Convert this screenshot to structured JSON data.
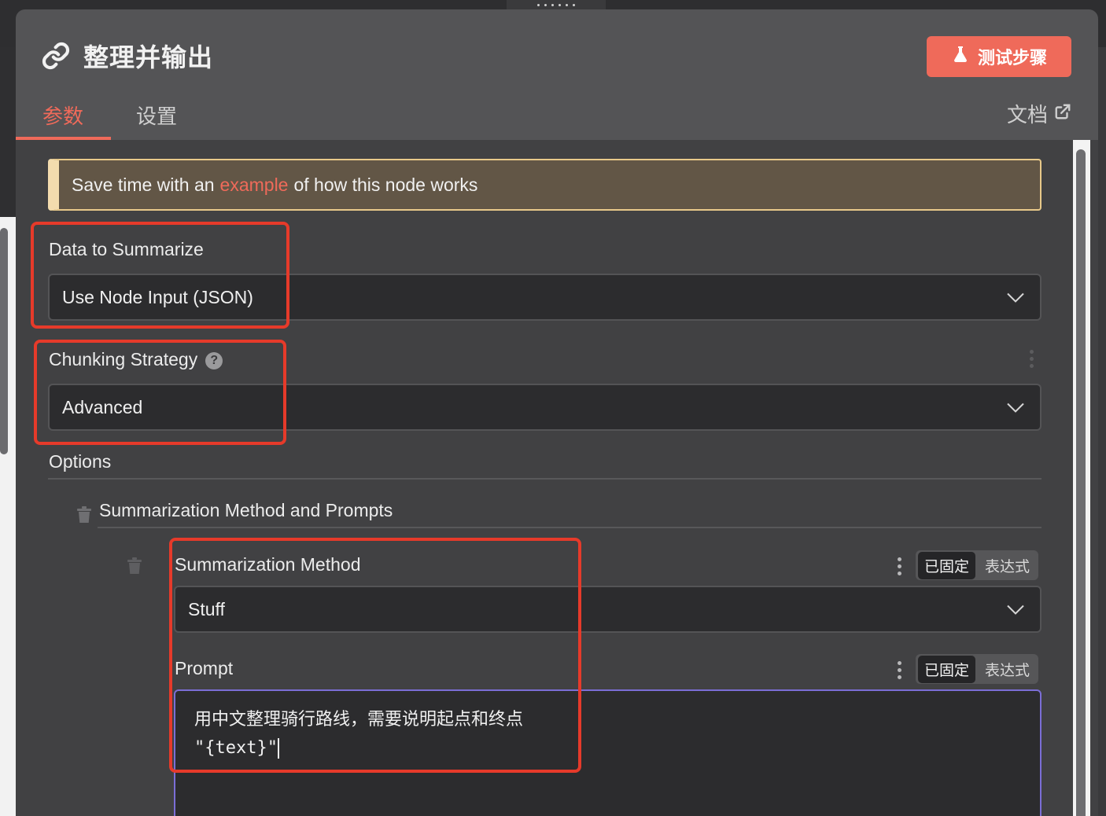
{
  "node": {
    "title": "整理并输出",
    "test_button": "测试步骤"
  },
  "tabs": [
    {
      "label": "参数",
      "active": true
    },
    {
      "label": "设置",
      "active": false
    }
  ],
  "docs_label": "文档",
  "banner": {
    "prefix": "Save time with an",
    "link": "example",
    "suffix": "of how this node works"
  },
  "fields": {
    "data_to_summarize": {
      "label": "Data to Summarize",
      "value": "Use Node Input (JSON)"
    },
    "chunking_strategy": {
      "label": "Chunking Strategy",
      "value": "Advanced"
    },
    "options_label": "Options",
    "summarization_group_label": "Summarization Method and Prompts",
    "summarization_method": {
      "label": "Summarization Method",
      "value": "Stuff"
    },
    "prompt": {
      "label": "Prompt",
      "line1": "用中文整理骑行路线，需要说明起点和终点",
      "line2": "\"{text}\""
    }
  },
  "mode_toggle": {
    "fixed": "已固定",
    "expression": "表达式"
  },
  "colors": {
    "accent": "#ef6a5a",
    "highlight": "#e63a2a",
    "focus": "#7b6ed6",
    "banner_bg": "#625646"
  },
  "icons": [
    "link-icon",
    "flask-icon",
    "external-link-icon",
    "help-icon",
    "chevron-down-icon",
    "trash-icon",
    "more-vertical-icon",
    "drag-handle-icon"
  ]
}
